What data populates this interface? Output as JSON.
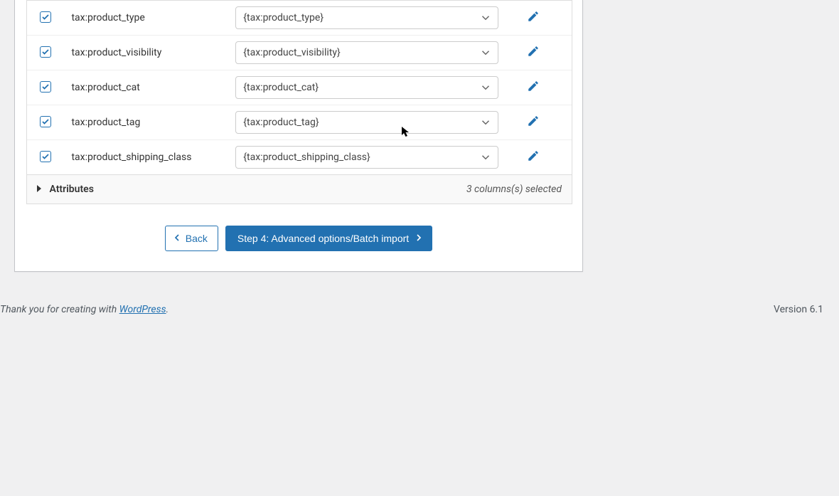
{
  "rows": [
    {
      "label": "tax:product_type",
      "value": "{tax:product_type}"
    },
    {
      "label": "tax:product_visibility",
      "value": "{tax:product_visibility}"
    },
    {
      "label": "tax:product_cat",
      "value": "{tax:product_cat}"
    },
    {
      "label": "tax:product_tag",
      "value": "{tax:product_tag}"
    },
    {
      "label": "tax:product_shipping_class",
      "value": "{tax:product_shipping_class}"
    }
  ],
  "section": {
    "title": "Attributes",
    "count": "3 columns(s) selected"
  },
  "buttons": {
    "back": "Back",
    "next": "Step 4: Advanced options/Batch import"
  },
  "footer": {
    "thanks_prefix": "Thank you for creating with ",
    "link_text": "WordPress",
    "thanks_suffix": ".",
    "version": "Version 6.1"
  },
  "colors": {
    "primary": "#2271b1"
  }
}
